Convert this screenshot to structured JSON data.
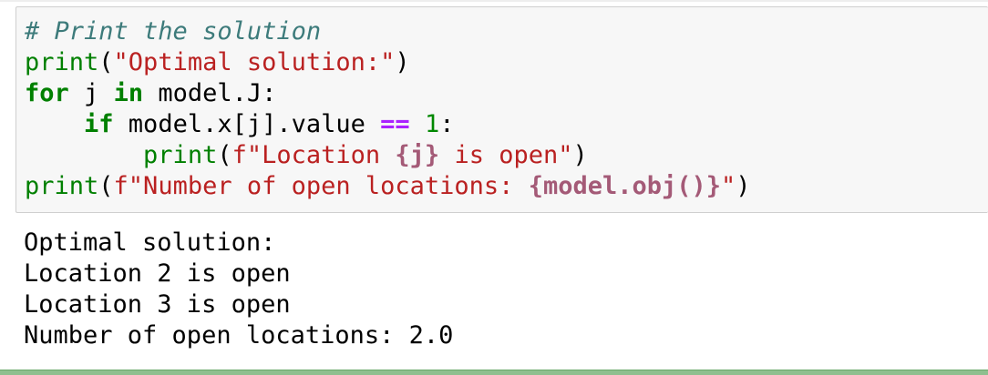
{
  "code_cell": {
    "lines": [
      [
        {
          "t": "# Print the solution",
          "c": "cm"
        }
      ],
      [
        {
          "t": "print",
          "c": "bi"
        },
        {
          "t": "(",
          "c": "pl"
        },
        {
          "t": "\"Optimal solution:\"",
          "c": "st"
        },
        {
          "t": ")",
          "c": "pl"
        }
      ],
      [
        {
          "t": "for",
          "c": "kw"
        },
        {
          "t": " j ",
          "c": "pl"
        },
        {
          "t": "in",
          "c": "kw"
        },
        {
          "t": " model.J:",
          "c": "pl"
        }
      ],
      [
        {
          "t": "    ",
          "c": "pl"
        },
        {
          "t": "if",
          "c": "kw"
        },
        {
          "t": " model.x[j].value ",
          "c": "pl"
        },
        {
          "t": "==",
          "c": "op"
        },
        {
          "t": " ",
          "c": "pl"
        },
        {
          "t": "1",
          "c": "nm"
        },
        {
          "t": ":",
          "c": "pl"
        }
      ],
      [
        {
          "t": "        ",
          "c": "pl"
        },
        {
          "t": "print",
          "c": "bi"
        },
        {
          "t": "(",
          "c": "pl"
        },
        {
          "t": "f\"Location ",
          "c": "st"
        },
        {
          "t": "{j}",
          "c": "si"
        },
        {
          "t": " is open\"",
          "c": "st"
        },
        {
          "t": ")",
          "c": "pl"
        }
      ],
      [
        {
          "t": "print",
          "c": "bi"
        },
        {
          "t": "(",
          "c": "pl"
        },
        {
          "t": "f\"Number of open locations: ",
          "c": "st"
        },
        {
          "t": "{model.obj()}",
          "c": "si"
        },
        {
          "t": "\"",
          "c": "st"
        },
        {
          "t": ")",
          "c": "pl"
        }
      ]
    ]
  },
  "output": {
    "lines": [
      "Optimal solution:",
      "Location 2 is open",
      "Location 3 is open",
      "Number of open locations: 2.0"
    ]
  }
}
